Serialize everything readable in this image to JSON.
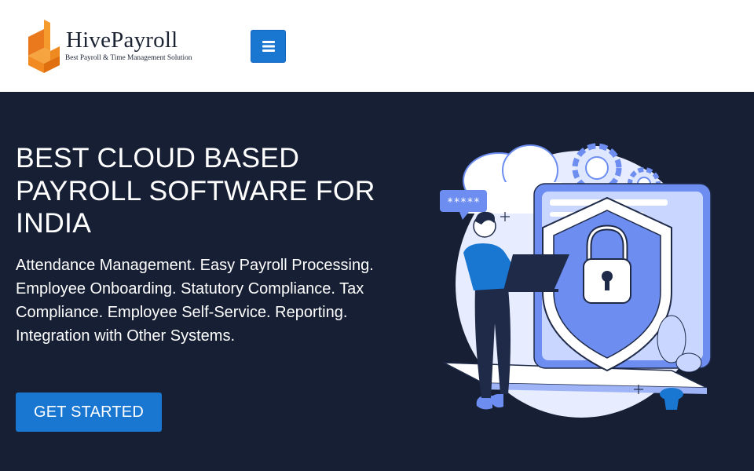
{
  "brand": {
    "name": "HivePayroll",
    "tagline": "Best Payroll & Time Management Solution",
    "logo_color": "#f08a24"
  },
  "header": {
    "menu_icon": "hamburger-menu-icon"
  },
  "hero": {
    "title": "BEST CLOUD BASED PAYROLL SOFTWARE FOR INDIA",
    "description": "Attendance Management. Easy Payroll Processing. Employee Onboarding. Statutory Compliance. Tax Compliance. Employee Self-Service. Reporting. Integration with Other Systems.",
    "cta_label": "GET STARTED",
    "illustration": {
      "icons": [
        "cloud-icon",
        "gear-icon",
        "shield-lock-icon",
        "laptop-icon",
        "plant-icon",
        "person-icon"
      ],
      "password_bubble": "*****"
    }
  },
  "colors": {
    "accent": "#1977d2",
    "hero_bg": "#171f34",
    "illustration_blue": "#6d8ef0"
  }
}
